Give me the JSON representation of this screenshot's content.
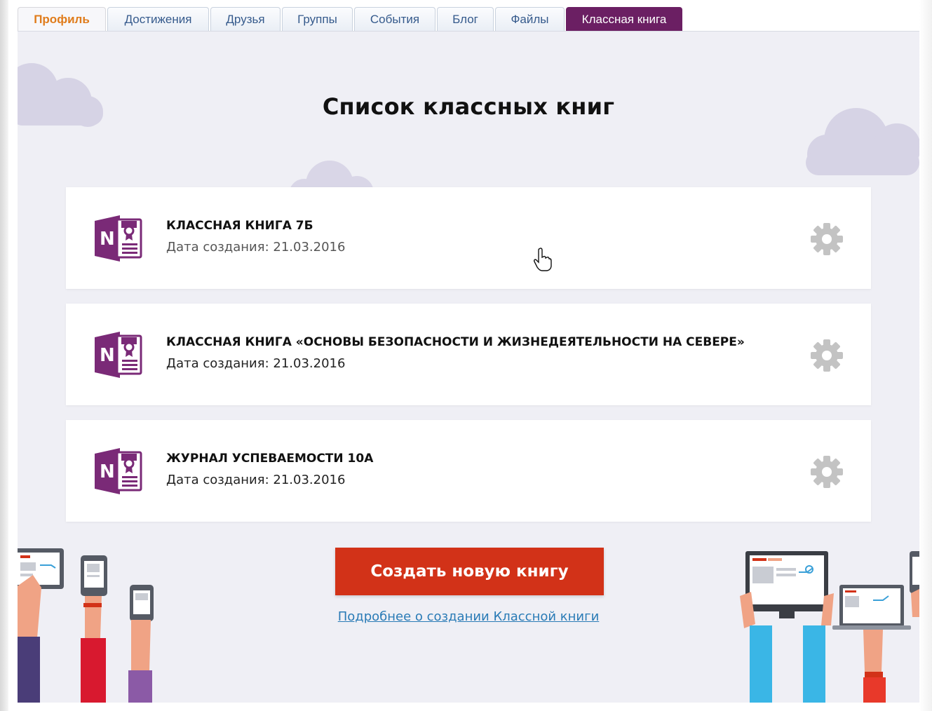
{
  "tabs": [
    {
      "label": "Профиль"
    },
    {
      "label": "Достижения"
    },
    {
      "label": "Друзья"
    },
    {
      "label": "Группы"
    },
    {
      "label": "События"
    },
    {
      "label": "Блог"
    },
    {
      "label": "Файлы"
    },
    {
      "label": "Классная книга"
    }
  ],
  "active_tab": "Классная книга",
  "page": {
    "title": "Список классных книг"
  },
  "books": [
    {
      "title": "Классная книга 7Б",
      "date": "Дата создания: 21.03.2016"
    },
    {
      "title": "Классная книга «Основы безопасности и жизнедеятельности на Севере»",
      "date": "Дата создания: 21.03.2016"
    },
    {
      "title": "Журнал успеваемости 10А",
      "date": "Дата создания: 21.03.2016"
    }
  ],
  "actions": {
    "create_label": "Создать новую книгу",
    "more_link": "Подробнее о создании Классной книги"
  },
  "icons": {
    "book": "onenote-notebook-icon",
    "settings": "gear-icon"
  },
  "colors": {
    "accent_purple": "#6b1f63",
    "onenote_purple": "#7a2a77",
    "create_button": "#d23218",
    "link": "#2a7bb6",
    "profile_tab": "#e07c1b",
    "tab_text": "#355a8c",
    "background": "#efeff5",
    "gear": "#c3c3c3"
  }
}
